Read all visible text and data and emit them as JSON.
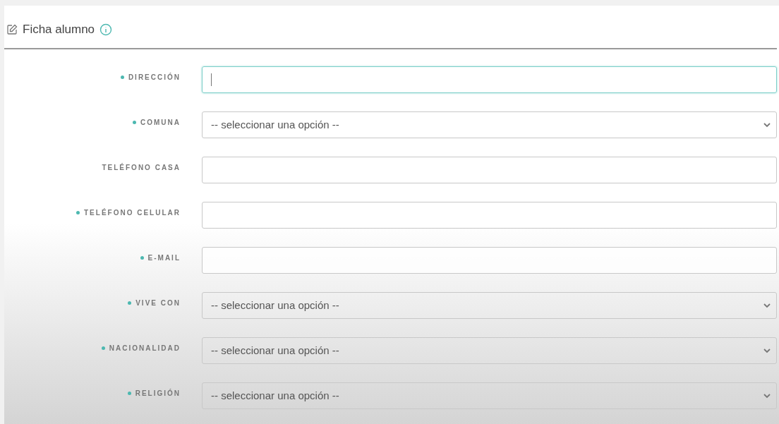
{
  "header": {
    "title": "Ficha alumno"
  },
  "fields": [
    {
      "label": "DIRECCIÓN",
      "required": true,
      "kind": "text",
      "focused": true
    },
    {
      "label": "COMUNA",
      "required": true,
      "kind": "select",
      "focused": false,
      "value": "-- seleccionar una opción --"
    },
    {
      "label": "TELÉFONO CASA",
      "required": false,
      "kind": "text",
      "focused": false
    },
    {
      "label": "TELÉFONO CELULAR",
      "required": true,
      "kind": "text",
      "focused": false
    },
    {
      "label": "E-MAIL",
      "required": true,
      "kind": "text",
      "focused": false
    },
    {
      "label": "VIVE CON",
      "required": true,
      "kind": "select",
      "focused": false,
      "value": "-- seleccionar una opción --"
    },
    {
      "label": "NACIONALIDAD",
      "required": true,
      "kind": "select",
      "focused": false,
      "value": "-- seleccionar una opción --"
    },
    {
      "label": "RELIGIÓN",
      "required": true,
      "kind": "select",
      "focused": false,
      "value": "-- seleccionar una opción --"
    }
  ]
}
